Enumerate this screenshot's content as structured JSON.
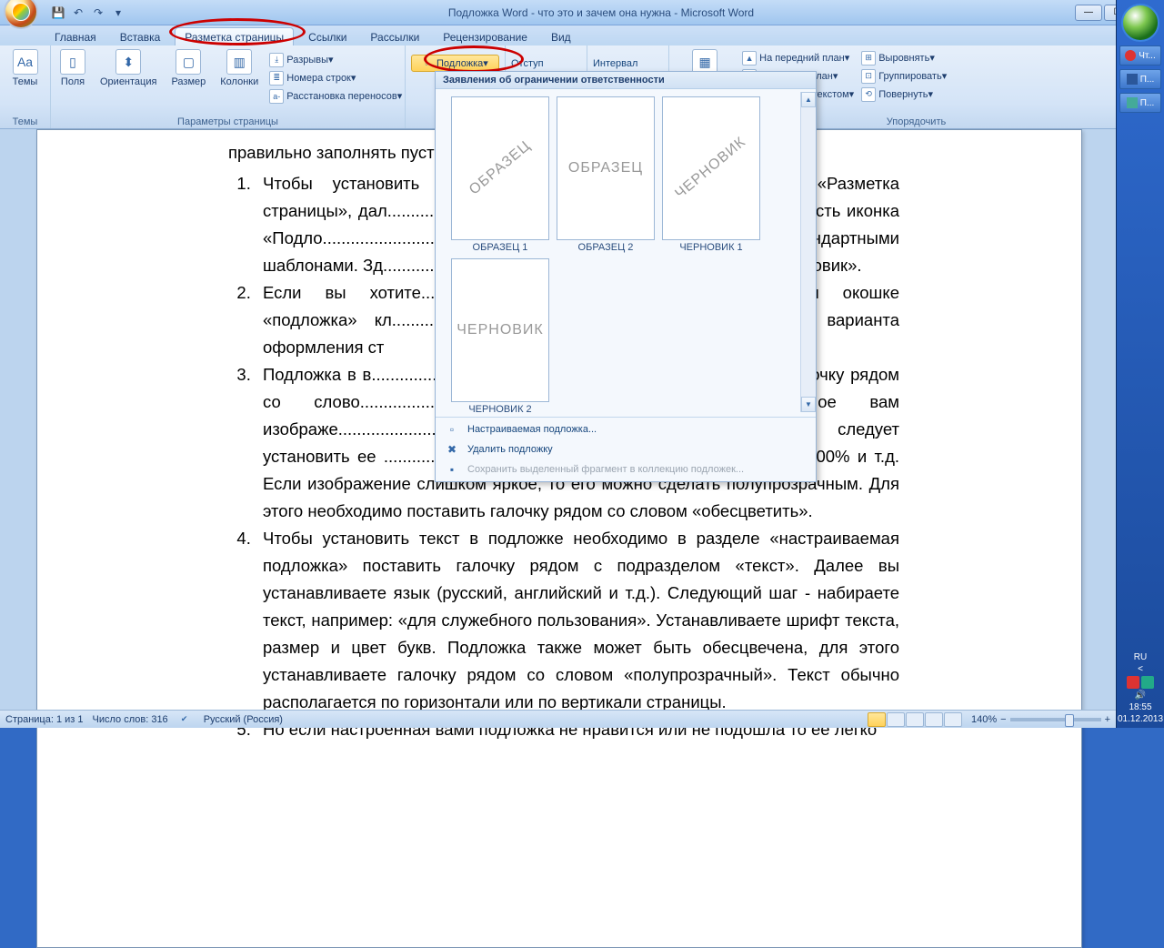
{
  "title": "Подложка Word - что это и зачем она нужна - Microsoft Word",
  "qat": {
    "save_tip": "Сохранить",
    "undo_tip": "Отменить",
    "redo_tip": "Повторить"
  },
  "tabs": [
    "Главная",
    "Вставка",
    "Разметка страницы",
    "Ссылки",
    "Рассылки",
    "Рецензирование",
    "Вид"
  ],
  "active_tab": 2,
  "ribbon": {
    "themes": {
      "label": "Темы",
      "btn": "Темы"
    },
    "pageSetup": {
      "label": "Параметры страницы",
      "fields": "Поля",
      "orient": "Ориентация",
      "size": "Размер",
      "cols": "Колонки",
      "breaks": "Разрывы",
      "lines": "Номера строк",
      "hyph": "Расстановка переносов"
    },
    "pageBg": {
      "watermark": "Подложка"
    },
    "indent_hdr": "Отступ",
    "spacing_hdr": "Интервал",
    "arrange": {
      "label": "Упорядочить",
      "pos": "Положение",
      "front": "На передний план",
      "back": "На задний план",
      "wrap": "Обтекание текстом",
      "align": "Выровнять",
      "group": "Группировать",
      "rotate": "Повернуть"
    }
  },
  "gallery": {
    "header": "Заявления об ограничении ответственности",
    "items": [
      {
        "text": "ОБРАЗЕЦ",
        "orient": "diag",
        "label": "ОБРАЗЕЦ 1"
      },
      {
        "text": "ОБРАЗЕЦ",
        "orient": "horiz",
        "label": "ОБРАЗЕЦ 2"
      },
      {
        "text": "ЧЕРНОВИК",
        "orient": "diag",
        "label": "ЧЕРНОВИК 1"
      },
      {
        "text": "ЧЕРНОВИК",
        "orient": "horiz",
        "label": "ЧЕРНОВИК 2"
      }
    ],
    "footer": {
      "custom": "Настраиваемая подложка...",
      "remove": "Удалить подложку",
      "save": "Сохранить выделенный фрагмент в коллекцию подложек..."
    }
  },
  "doc": {
    "lead": "правильно заполнять пустые п",
    "items": [
      "Чтобы установить ........................................................... вкладке «Разметка страницы», дал................................................................верху раздела есть иконка «Подло.....................................................................но со стандартными шаблонами. Зд........................................................................ец» и «черновик».",
      "Если вы хотите..................................................................крывшемся окошке «подложка» кл.................................................................. Здесь два варианта оформления ст",
      "Подложка в в.....................................................................а» ставите галочку рядом со слово...............................................................одите необходимое вам изображе................................................................лая картинка, следует установить ее ................................................................... авто, 500%, 100% и т.д. Если изображение слишком яркое, то его можно сделать полупрозрачным. Для этого необходимо поставить галочку рядом со словом «обесцветить».",
      "Чтобы установить текст в подложке необходимо в разделе «настраиваемая подложка» поставить галочку рядом с подразделом «текст». Далее вы устанавливаете язык (русский, английский и т.д.). Следующий шаг  - набираете текст, например: «для служебного пользования». Устанавливаете шрифт текста, размер и цвет букв.  Подложка также может быть обесцвечена, для этого устанавливаете галочку рядом со словом «полупрозрачный». Текст обычно располагается по горизонтали или по вертикали страницы.",
      "Но если настроенная вами подложка не нравится или не подошла то ее легко"
    ]
  },
  "status": {
    "page": "Страница: 1 из 1",
    "words": "Число слов: 316",
    "lang": "Русский (Россия)",
    "zoom": "140%"
  },
  "tray": {
    "lang": "RU",
    "time": "18:55",
    "date": "01.12.2013"
  },
  "taskbar": {
    "chrome": "Чт...",
    "word": "П...",
    "paint": "П..."
  }
}
